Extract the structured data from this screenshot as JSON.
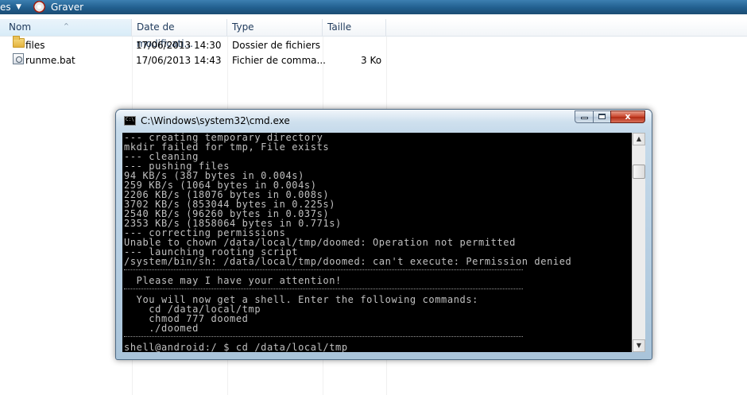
{
  "toolbar": {
    "organize_partial": "es",
    "burn_label": "Graver"
  },
  "columns": {
    "name": "Nom",
    "date": "Date de modificati...",
    "type": "Type",
    "size": "Taille"
  },
  "files": [
    {
      "icon": "folder-icon",
      "name": "files",
      "date": "17/06/2013 14:30",
      "type": "Dossier de fichiers",
      "size": ""
    },
    {
      "icon": "bat-file-icon",
      "name": "runme.bat",
      "date": "17/06/2013 14:43",
      "type": "Fichier de comma...",
      "size": "3 Ko"
    }
  ],
  "cmd": {
    "title": "C:\\Windows\\system32\\cmd.exe",
    "close_glyph": "x",
    "block1": "--- creating temporary directory\nmkdir failed for tmp, File exists\n--- cleaning\n--- pushing files\n94 KB/s (387 bytes in 0.004s)\n259 KB/s (1064 bytes in 0.004s)\n2206 KB/s (18076 bytes in 0.008s)\n3702 KB/s (853044 bytes in 0.225s)\n2540 KB/s (96260 bytes in 0.037s)\n2353 KB/s (1858064 bytes in 0.771s)\n--- correcting permissions\nUnable to chown /data/local/tmp/doomed: Operation not permitted\n--- launching rooting script\n/system/bin/sh: /data/local/tmp/doomed: can't execute: Permission denied",
    "block2": "  Please may I have your attention!",
    "block3": "  You will now get a shell. Enter the following commands:\n    cd /data/local/tmp\n    chmod 777 doomed\n    ./doomed",
    "prompt": "shell@android:/ $ cd /data/local/tmp"
  }
}
